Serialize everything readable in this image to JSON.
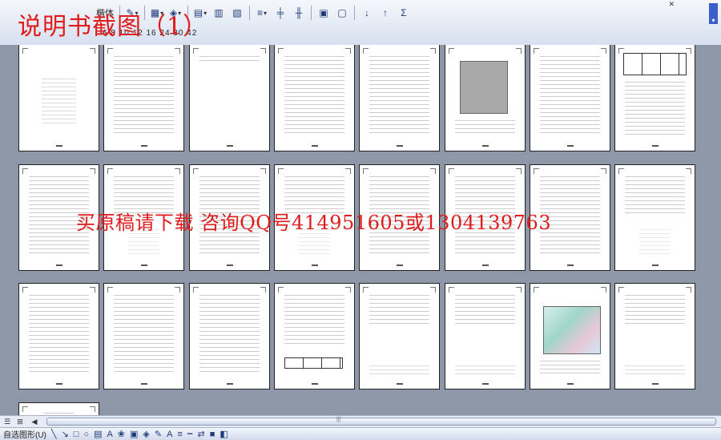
{
  "overlay_title": "说明书截图（1）",
  "watermark_text": "买原稿请下载  咨询QQ号414951605或1304139763",
  "toolbar": {
    "font_name": "楷体",
    "ruler_text": "6  8  10 12 16 24 30  42"
  },
  "drawing_bar": {
    "select_objects_label": "自选图形(U)",
    "draw_label": ""
  },
  "pages": [
    {
      "row": 0,
      "col": 0,
      "kind": "cover"
    },
    {
      "row": 0,
      "col": 1,
      "kind": "toc"
    },
    {
      "row": 0,
      "col": 2,
      "kind": "mostly-blank"
    },
    {
      "row": 0,
      "col": 3,
      "kind": "text"
    },
    {
      "row": 0,
      "col": 4,
      "kind": "text"
    },
    {
      "row": 0,
      "col": 5,
      "kind": "figure-gray"
    },
    {
      "row": 0,
      "col": 6,
      "kind": "text"
    },
    {
      "row": 0,
      "col": 7,
      "kind": "table"
    },
    {
      "row": 1,
      "col": 0,
      "kind": "text"
    },
    {
      "row": 1,
      "col": 1,
      "kind": "text-figure"
    },
    {
      "row": 1,
      "col": 2,
      "kind": "text"
    },
    {
      "row": 1,
      "col": 3,
      "kind": "text-figure"
    },
    {
      "row": 1,
      "col": 4,
      "kind": "text"
    },
    {
      "row": 1,
      "col": 5,
      "kind": "text"
    },
    {
      "row": 1,
      "col": 6,
      "kind": "text"
    },
    {
      "row": 1,
      "col": 7,
      "kind": "text-figure"
    },
    {
      "row": 2,
      "col": 0,
      "kind": "text"
    },
    {
      "row": 2,
      "col": 1,
      "kind": "text"
    },
    {
      "row": 2,
      "col": 2,
      "kind": "text"
    },
    {
      "row": 2,
      "col": 3,
      "kind": "text-table"
    },
    {
      "row": 2,
      "col": 4,
      "kind": "sparse"
    },
    {
      "row": 2,
      "col": 5,
      "kind": "sparse"
    },
    {
      "row": 2,
      "col": 6,
      "kind": "figure-color"
    },
    {
      "row": 2,
      "col": 7,
      "kind": "sparse"
    },
    {
      "row": 3,
      "col": 0,
      "kind": "partial"
    }
  ]
}
